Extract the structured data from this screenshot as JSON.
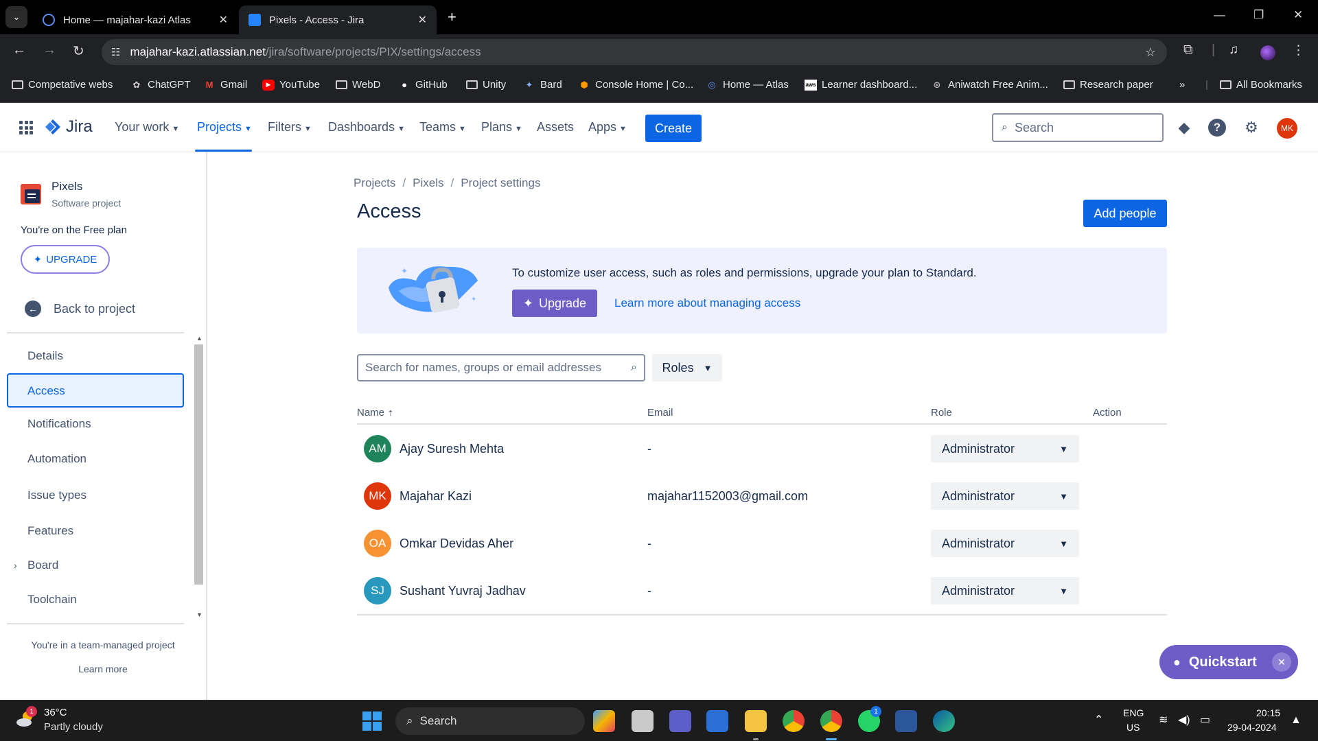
{
  "browser": {
    "tabs": [
      {
        "title": "Home — majahar-kazi Atlas",
        "active": false
      },
      {
        "title": "Pixels - Access - Jira",
        "active": true
      }
    ],
    "url_host": "majahar-kazi.atlassian.net",
    "url_path": "/jira/software/projects/PIX/settings/access",
    "bookmarks": [
      {
        "label": "Competative webs",
        "icon": "folder-icon"
      },
      {
        "label": "ChatGPT",
        "icon": "chatgpt-icon"
      },
      {
        "label": "Gmail",
        "icon": "gmail-icon"
      },
      {
        "label": "YouTube",
        "icon": "youtube-icon"
      },
      {
        "label": "WebD",
        "icon": "folder-icon"
      },
      {
        "label": "GitHub",
        "icon": "github-icon"
      },
      {
        "label": "Unity",
        "icon": "folder-icon"
      },
      {
        "label": "Bard",
        "icon": "bard-icon"
      },
      {
        "label": "Console Home | Co...",
        "icon": "aws-icon"
      },
      {
        "label": "Home — Atlas",
        "icon": "atlas-icon"
      },
      {
        "label": "Learner dashboard...",
        "icon": "aws-icon"
      },
      {
        "label": "Aniwatch Free Anim...",
        "icon": "aniwatch-icon"
      },
      {
        "label": "Research paper",
        "icon": "folder-icon"
      }
    ],
    "bookmarks_overflow": "»",
    "all_bookmarks": "All Bookmarks"
  },
  "jira_nav": {
    "logo_text": "Jira",
    "items": [
      {
        "label": "Your work",
        "dropdown": true
      },
      {
        "label": "Projects",
        "dropdown": true,
        "active": true
      },
      {
        "label": "Filters",
        "dropdown": true
      },
      {
        "label": "Dashboards",
        "dropdown": true
      },
      {
        "label": "Teams",
        "dropdown": true
      },
      {
        "label": "Plans",
        "dropdown": true
      },
      {
        "label": "Assets",
        "dropdown": false
      },
      {
        "label": "Apps",
        "dropdown": true
      }
    ],
    "create_label": "Create",
    "search_placeholder": "Search",
    "avatar_initials": "MK",
    "brand_color": "#0c66e4"
  },
  "sidebar": {
    "project_name": "Pixels",
    "project_type": "Software project",
    "plan_text": "You're on the Free plan",
    "upgrade_label": "UPGRADE",
    "back_label": "Back to project",
    "items": [
      {
        "label": "Details"
      },
      {
        "label": "Access",
        "active": true
      },
      {
        "label": "Notifications"
      },
      {
        "label": "Automation"
      },
      {
        "label": "Issue types"
      },
      {
        "label": "Features"
      },
      {
        "label": "Board",
        "expandable": true
      },
      {
        "label": "Toolchain"
      }
    ],
    "footer_text": "You're in a team-managed project",
    "learn_more": "Learn more"
  },
  "main": {
    "breadcrumb": [
      "Projects",
      "Pixels",
      "Project settings"
    ],
    "title": "Access",
    "add_people_label": "Add people",
    "banner": {
      "text": "To customize user access, such as roles and permissions, upgrade your plan to Standard.",
      "upgrade_label": "Upgrade",
      "link_label": "Learn more about managing access"
    },
    "search_placeholder": "Search for names, groups or email addresses",
    "roles_label": "Roles",
    "columns": [
      "Name",
      "Email",
      "Role",
      "Action"
    ],
    "sort_indicator": "⇡",
    "rows": [
      {
        "initials": "AM",
        "name": "Ajay Suresh Mehta",
        "email": "-",
        "role": "Administrator",
        "color": "#1f845a"
      },
      {
        "initials": "MK",
        "name": "Majahar Kazi",
        "email": "majahar1152003@gmail.com",
        "role": "Administrator",
        "color": "#de350b"
      },
      {
        "initials": "OA",
        "name": "Omkar Devidas Aher",
        "email": "-",
        "role": "Administrator",
        "color": "#f79233"
      },
      {
        "initials": "SJ",
        "name": "Sushant Yuvraj Jadhav",
        "email": "-",
        "role": "Administrator",
        "color": "#2898bd"
      }
    ]
  },
  "quickstart": {
    "label": "Quickstart"
  },
  "taskbar": {
    "weather_temp": "36°C",
    "weather_desc": "Partly cloudy",
    "weather_badge": "1",
    "search_label": "Search",
    "whatsapp_badge": "1",
    "lang_line1": "ENG",
    "lang_line2": "US",
    "time": "20:15",
    "date": "29-04-2024"
  }
}
